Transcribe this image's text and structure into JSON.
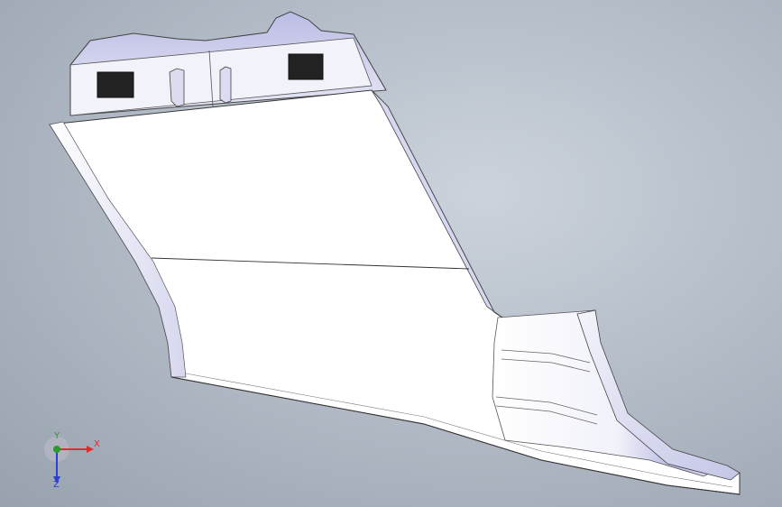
{
  "viewport": {
    "background_center": "#ccd3dc",
    "background_edge": "#98a2af"
  },
  "part": {
    "face_color": "#ffffff",
    "edge_color": "#3a3a3a",
    "shade_color": "#cfd0ea"
  },
  "triad": {
    "x_label": "X",
    "y_label": "Y",
    "z_label": "Z",
    "x_color": "#e22b2b",
    "y_color": "#2a9a2a",
    "z_color": "#2b3fd0"
  }
}
